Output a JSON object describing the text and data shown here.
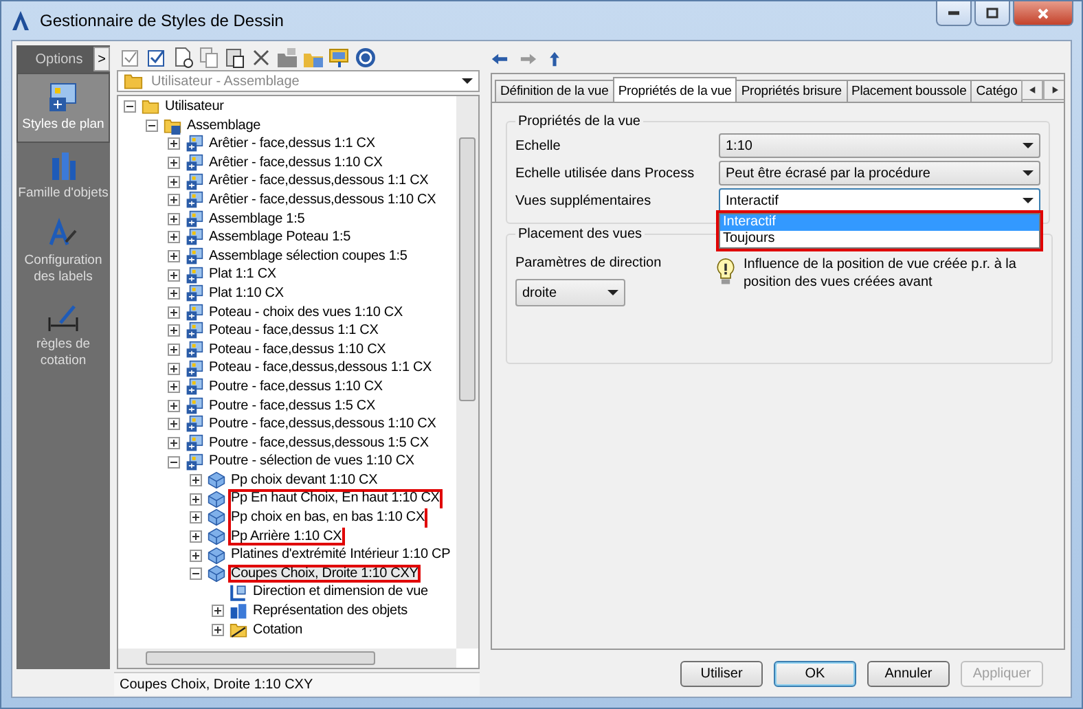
{
  "window": {
    "title": "Gestionnaire de Styles de Dessin"
  },
  "sidebar": {
    "header": "Options",
    "expand_button": ">",
    "items": [
      {
        "label": "Styles de plan",
        "kind": "plan",
        "selected": true
      },
      {
        "label": "Famille d'objets",
        "kind": "family",
        "selected": false
      },
      {
        "label": "Configuration des labels",
        "kind": "labels",
        "selected": false
      },
      {
        "label": "règles de cotation",
        "kind": "dimension",
        "selected": false
      }
    ]
  },
  "path_combo": {
    "value": "Utilisateur - Assemblage"
  },
  "tree": [
    {
      "label": "Utilisateur",
      "kind": "folder",
      "expanded": true,
      "selected": false,
      "highlighted": false,
      "children": [
        {
          "label": "Assemblage",
          "kind": "folder-style",
          "expanded": true,
          "selected": false,
          "highlighted": false,
          "children": [
            {
              "label": "Arêtier - face,dessus 1:1 CX",
              "kind": "style",
              "expanded": false,
              "selected": false,
              "highlighted": false
            },
            {
              "label": "Arêtier - face,dessus 1:10 CX",
              "kind": "style",
              "expanded": false,
              "selected": false,
              "highlighted": false
            },
            {
              "label": "Arêtier - face,dessus,dessous 1:1 CX",
              "kind": "style",
              "expanded": false,
              "selected": false,
              "highlighted": false
            },
            {
              "label": "Arêtier - face,dessus,dessous 1:10 CX",
              "kind": "style",
              "expanded": false,
              "selected": false,
              "highlighted": false
            },
            {
              "label": "Assemblage 1:5",
              "kind": "style",
              "expanded": false,
              "selected": false,
              "highlighted": false
            },
            {
              "label": "Assemblage Poteau 1:5",
              "kind": "style",
              "expanded": false,
              "selected": false,
              "highlighted": false
            },
            {
              "label": "Assemblage sélection coupes 1:5",
              "kind": "style",
              "expanded": false,
              "selected": false,
              "highlighted": false
            },
            {
              "label": "Plat 1:1 CX",
              "kind": "style",
              "expanded": false,
              "selected": false,
              "highlighted": false
            },
            {
              "label": "Plat 1:10 CX",
              "kind": "style",
              "expanded": false,
              "selected": false,
              "highlighted": false
            },
            {
              "label": "Poteau - choix des vues 1:10 CX",
              "kind": "style",
              "expanded": false,
              "selected": false,
              "highlighted": false
            },
            {
              "label": "Poteau - face,dessus 1:1 CX",
              "kind": "style",
              "expanded": false,
              "selected": false,
              "highlighted": false
            },
            {
              "label": "Poteau - face,dessus 1:10 CX",
              "kind": "style",
              "expanded": false,
              "selected": false,
              "highlighted": false
            },
            {
              "label": "Poteau - face,dessus,dessous 1:1 CX",
              "kind": "style",
              "expanded": false,
              "selected": false,
              "highlighted": false
            },
            {
              "label": "Poutre - face,dessus 1:10 CX",
              "kind": "style",
              "expanded": false,
              "selected": false,
              "highlighted": false
            },
            {
              "label": "Poutre - face,dessus 1:5 CX",
              "kind": "style",
              "expanded": false,
              "selected": false,
              "highlighted": false
            },
            {
              "label": "Poutre - face,dessus,dessous 1:10 CX",
              "kind": "style",
              "expanded": false,
              "selected": false,
              "highlighted": false
            },
            {
              "label": "Poutre - face,dessus,dessous 1:5 CX",
              "kind": "style",
              "expanded": false,
              "selected": false,
              "highlighted": false
            },
            {
              "label": "Poutre - sélection de vues 1:10 CX",
              "kind": "style",
              "expanded": true,
              "selected": false,
              "highlighted": false,
              "children": [
                {
                  "label": "Pp choix devant 1:10 CX",
                  "kind": "view",
                  "expanded": false,
                  "selected": false,
                  "highlighted": false
                },
                {
                  "label": "Pp En haut Choix, En haut 1:10 CX",
                  "kind": "view",
                  "expanded": false,
                  "selected": false,
                  "highlighted": true
                },
                {
                  "label": "Pp choix en bas, en bas 1:10 CX",
                  "kind": "view",
                  "expanded": false,
                  "selected": false,
                  "highlighted": true
                },
                {
                  "label": "Pp Arrière 1:10 CX",
                  "kind": "view",
                  "expanded": false,
                  "selected": false,
                  "highlighted": true
                },
                {
                  "label": "Platines d'extrémité Intérieur 1:10 CP",
                  "kind": "view",
                  "expanded": false,
                  "selected": false,
                  "highlighted": false
                },
                {
                  "label": "Coupes Choix, Droite 1:10 CXY",
                  "kind": "view",
                  "expanded": true,
                  "selected": true,
                  "highlighted": true,
                  "children": [
                    {
                      "label": "Direction et dimension de vue",
                      "kind": "direction",
                      "selected": false,
                      "highlighted": false
                    },
                    {
                      "label": "Représentation des objets",
                      "kind": "representation",
                      "expanded": false,
                      "selected": false,
                      "highlighted": false
                    },
                    {
                      "label": "Cotation",
                      "kind": "cotation",
                      "expanded": false,
                      "selected": false,
                      "highlighted": false
                    }
                  ]
                }
              ]
            }
          ]
        }
      ]
    }
  ],
  "tabs": [
    {
      "label": "Définition de la vue",
      "selected": false
    },
    {
      "label": "Propriétés de la vue",
      "selected": true
    },
    {
      "label": "Propriétés brisure",
      "selected": false
    },
    {
      "label": "Placement boussole",
      "selected": false
    },
    {
      "label": "Catégo",
      "selected": false
    }
  ],
  "view_properties": {
    "title": "Propriétés de la vue",
    "rows": [
      {
        "label": "Echelle",
        "value": "1:10",
        "open": false
      },
      {
        "label": "Echelle utilisée dans Process",
        "value": "Peut être écrasé par la procédure",
        "open": false
      },
      {
        "label": "Vues supplémentaires",
        "value": "Interactif",
        "open": true
      }
    ],
    "dropdown": {
      "highlighted": true,
      "options": [
        {
          "label": "Interactif",
          "selected": true
        },
        {
          "label": "Toujours",
          "selected": false
        }
      ]
    }
  },
  "view_placement": {
    "title": "Placement des vues",
    "label": "Paramètres de direction",
    "value": "droite",
    "hint": "Influence de la position de vue créée p.r. à la position des vues créées avant"
  },
  "status_bar": "Coupes Choix, Droite 1:10 CXY",
  "buttons": [
    {
      "label": "Utiliser",
      "kind": "normal",
      "disabled": false
    },
    {
      "label": "OK",
      "kind": "default",
      "disabled": false
    },
    {
      "label": "Annuler",
      "kind": "normal",
      "disabled": false
    },
    {
      "label": "Appliquer",
      "kind": "normal",
      "disabled": true
    }
  ]
}
